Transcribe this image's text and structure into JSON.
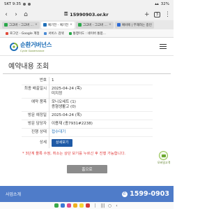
{
  "status_bar": {
    "time": "SKT 9:35",
    "battery": "32%"
  },
  "browser": {
    "url": "15990903.or.kr",
    "tab_count": "3"
  },
  "tabs": [
    {
      "label": "그고버 - 그고버 ...",
      "active": false
    },
    {
      "label": "예기전 - 예기전",
      "active": true
    },
    {
      "label": "그고버 - 그고버 ...",
      "active": false
    },
    {
      "label": "예비에 | 부재하는 중인",
      "active": false
    }
  ],
  "bookmarks": [
    {
      "label": "로그인 - Google 계정"
    },
    {
      "label": "서비스 검색"
    },
    {
      "label": "통행이도 : 네이버 통합..."
    }
  ],
  "site": {
    "logo_main": "순환거버넌스",
    "logo_sub": "Cycle Governance"
  },
  "page": {
    "title": "예약내용 조회",
    "rows": [
      {
        "key": "번호",
        "value": "1"
      },
      {
        "key": "최종 배출일시",
        "value": "2025-04-24 (목)\n미지정"
      },
      {
        "key": "예약 품목",
        "value": "모니오세트 (1)\n증형생활고 (0)"
      },
      {
        "key": "방문 예정일",
        "value": "2025-04-24 (목)"
      },
      {
        "key": "방문 담당자",
        "value": "이용재 (종7931#2238)"
      }
    ],
    "status_key": "진행 상태",
    "status_value": "접수대기",
    "detail_key": "상세",
    "detail_button": "상세보기",
    "notice": "* 3단계 플록 수정, 취소는 상단 보기를 누르신 후 진행 가능합니다.",
    "home_button": "홈으로"
  },
  "side_widget": {
    "label": "모바일고객"
  },
  "footer": {
    "left": "사업소개",
    "phone": "1599-0903"
  }
}
